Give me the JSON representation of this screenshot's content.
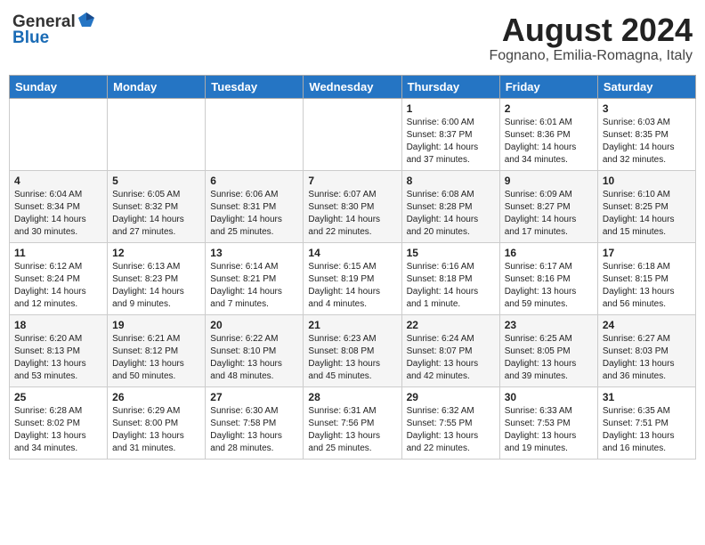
{
  "header": {
    "logo_general": "General",
    "logo_blue": "Blue",
    "month": "August 2024",
    "location": "Fognano, Emilia-Romagna, Italy"
  },
  "days_of_week": [
    "Sunday",
    "Monday",
    "Tuesday",
    "Wednesday",
    "Thursday",
    "Friday",
    "Saturday"
  ],
  "weeks": [
    [
      {
        "day": "",
        "info": ""
      },
      {
        "day": "",
        "info": ""
      },
      {
        "day": "",
        "info": ""
      },
      {
        "day": "",
        "info": ""
      },
      {
        "day": "1",
        "info": "Sunrise: 6:00 AM\nSunset: 8:37 PM\nDaylight: 14 hours\nand 37 minutes."
      },
      {
        "day": "2",
        "info": "Sunrise: 6:01 AM\nSunset: 8:36 PM\nDaylight: 14 hours\nand 34 minutes."
      },
      {
        "day": "3",
        "info": "Sunrise: 6:03 AM\nSunset: 8:35 PM\nDaylight: 14 hours\nand 32 minutes."
      }
    ],
    [
      {
        "day": "4",
        "info": "Sunrise: 6:04 AM\nSunset: 8:34 PM\nDaylight: 14 hours\nand 30 minutes."
      },
      {
        "day": "5",
        "info": "Sunrise: 6:05 AM\nSunset: 8:32 PM\nDaylight: 14 hours\nand 27 minutes."
      },
      {
        "day": "6",
        "info": "Sunrise: 6:06 AM\nSunset: 8:31 PM\nDaylight: 14 hours\nand 25 minutes."
      },
      {
        "day": "7",
        "info": "Sunrise: 6:07 AM\nSunset: 8:30 PM\nDaylight: 14 hours\nand 22 minutes."
      },
      {
        "day": "8",
        "info": "Sunrise: 6:08 AM\nSunset: 8:28 PM\nDaylight: 14 hours\nand 20 minutes."
      },
      {
        "day": "9",
        "info": "Sunrise: 6:09 AM\nSunset: 8:27 PM\nDaylight: 14 hours\nand 17 minutes."
      },
      {
        "day": "10",
        "info": "Sunrise: 6:10 AM\nSunset: 8:25 PM\nDaylight: 14 hours\nand 15 minutes."
      }
    ],
    [
      {
        "day": "11",
        "info": "Sunrise: 6:12 AM\nSunset: 8:24 PM\nDaylight: 14 hours\nand 12 minutes."
      },
      {
        "day": "12",
        "info": "Sunrise: 6:13 AM\nSunset: 8:23 PM\nDaylight: 14 hours\nand 9 minutes."
      },
      {
        "day": "13",
        "info": "Sunrise: 6:14 AM\nSunset: 8:21 PM\nDaylight: 14 hours\nand 7 minutes."
      },
      {
        "day": "14",
        "info": "Sunrise: 6:15 AM\nSunset: 8:19 PM\nDaylight: 14 hours\nand 4 minutes."
      },
      {
        "day": "15",
        "info": "Sunrise: 6:16 AM\nSunset: 8:18 PM\nDaylight: 14 hours\nand 1 minute."
      },
      {
        "day": "16",
        "info": "Sunrise: 6:17 AM\nSunset: 8:16 PM\nDaylight: 13 hours\nand 59 minutes."
      },
      {
        "day": "17",
        "info": "Sunrise: 6:18 AM\nSunset: 8:15 PM\nDaylight: 13 hours\nand 56 minutes."
      }
    ],
    [
      {
        "day": "18",
        "info": "Sunrise: 6:20 AM\nSunset: 8:13 PM\nDaylight: 13 hours\nand 53 minutes."
      },
      {
        "day": "19",
        "info": "Sunrise: 6:21 AM\nSunset: 8:12 PM\nDaylight: 13 hours\nand 50 minutes."
      },
      {
        "day": "20",
        "info": "Sunrise: 6:22 AM\nSunset: 8:10 PM\nDaylight: 13 hours\nand 48 minutes."
      },
      {
        "day": "21",
        "info": "Sunrise: 6:23 AM\nSunset: 8:08 PM\nDaylight: 13 hours\nand 45 minutes."
      },
      {
        "day": "22",
        "info": "Sunrise: 6:24 AM\nSunset: 8:07 PM\nDaylight: 13 hours\nand 42 minutes."
      },
      {
        "day": "23",
        "info": "Sunrise: 6:25 AM\nSunset: 8:05 PM\nDaylight: 13 hours\nand 39 minutes."
      },
      {
        "day": "24",
        "info": "Sunrise: 6:27 AM\nSunset: 8:03 PM\nDaylight: 13 hours\nand 36 minutes."
      }
    ],
    [
      {
        "day": "25",
        "info": "Sunrise: 6:28 AM\nSunset: 8:02 PM\nDaylight: 13 hours\nand 34 minutes."
      },
      {
        "day": "26",
        "info": "Sunrise: 6:29 AM\nSunset: 8:00 PM\nDaylight: 13 hours\nand 31 minutes."
      },
      {
        "day": "27",
        "info": "Sunrise: 6:30 AM\nSunset: 7:58 PM\nDaylight: 13 hours\nand 28 minutes."
      },
      {
        "day": "28",
        "info": "Sunrise: 6:31 AM\nSunset: 7:56 PM\nDaylight: 13 hours\nand 25 minutes."
      },
      {
        "day": "29",
        "info": "Sunrise: 6:32 AM\nSunset: 7:55 PM\nDaylight: 13 hours\nand 22 minutes."
      },
      {
        "day": "30",
        "info": "Sunrise: 6:33 AM\nSunset: 7:53 PM\nDaylight: 13 hours\nand 19 minutes."
      },
      {
        "day": "31",
        "info": "Sunrise: 6:35 AM\nSunset: 7:51 PM\nDaylight: 13 hours\nand 16 minutes."
      }
    ]
  ]
}
